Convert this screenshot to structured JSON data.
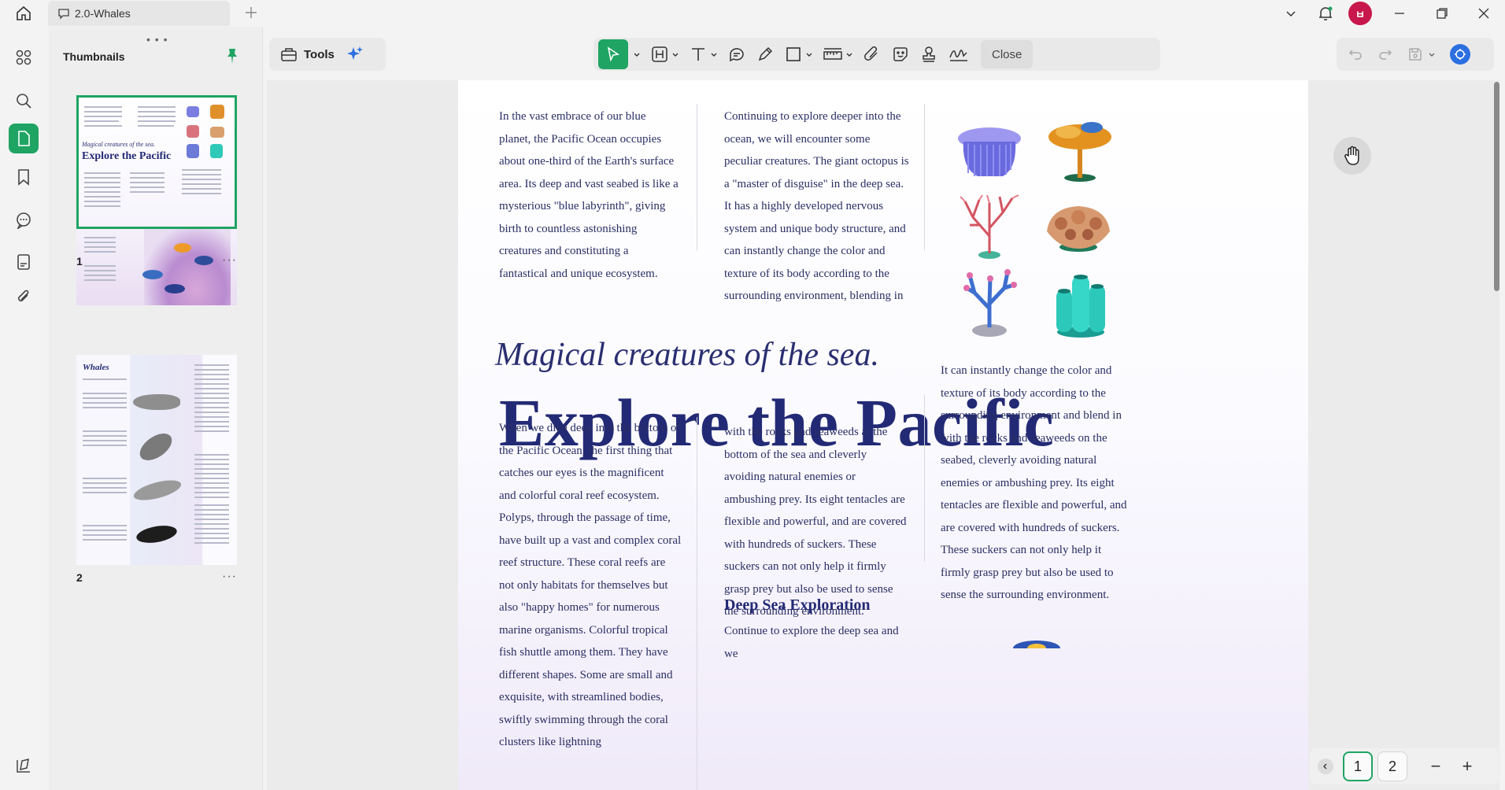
{
  "titlebar": {
    "tab_title": "2.0-Whales",
    "avatar_initial": "ㅂ"
  },
  "sidebar": {
    "title": "Thumbnails",
    "pages": [
      {
        "number": "1",
        "mini_subtitle": "Magical creatures of the sea.",
        "mini_title": "Explore the Pacific"
      },
      {
        "number": "2",
        "mini_title": "Whales"
      }
    ]
  },
  "toolbar": {
    "tools_label": "Tools",
    "close_label": "Close"
  },
  "document": {
    "col1_top": "In the vast embrace of our blue planet, the Pacific Ocean occupies about one-third of the Earth's surface area. Its deep and vast seabed is like a mysterious \"blue labyrinth\", giving birth to countless astonishing creatures and constituting a fantastical and unique ecosystem.",
    "col2_top": "Continuing to explore deeper into the ocean, we will encounter some peculiar creatures. The giant octopus is a \"master of disguise\" in the deep sea. It has a highly developed nervous system and unique body structure, and can instantly change the color and texture of its body according to the surrounding environment, blending in",
    "subtitle": "Magical creatures of the sea.",
    "title": "Explore the Pacific",
    "col3_mid": "It can instantly change the color and texture of its body according to the surrounding environment and blend in with the rocks and seaweeds on the seabed, cleverly avoiding natural enemies or ambushing prey. Its eight tentacles are flexible and powerful, and are covered with hundreds of suckers. These suckers can not only help it firmly grasp prey but also be used to sense the surrounding environment.",
    "col1_bottom": "When we dive deep into the bottom of the Pacific Ocean, the first thing that catches our eyes is the magnificent and colorful coral reef ecosystem. Polyps, through the passage of time, have built up a vast and complex coral reef structure. These coral reefs are not only habitats for themselves but also \"happy homes\" for numerous marine organisms. Colorful tropical fish shuttle among them. They have different shapes. Some are small and exquisite, with streamlined bodies, swiftly swimming through the coral clusters like lightning",
    "col2_bottom": "with the rocks and seaweeds at the bottom of the sea and cleverly avoiding natural enemies or ambushing prey. Its eight tentacles are flexible and powerful, and are covered with hundreds of suckers. These suckers can not only help it firmly grasp prey but also be used to sense the surrounding environment.",
    "heading": "Deep Sea Exploration",
    "col2_tail": "Continue to explore the deep sea and we"
  },
  "pager": {
    "page1": "1",
    "page2": "2",
    "zoom_out": "−",
    "zoom_in": "+"
  },
  "colors": {
    "accent": "#1fa463",
    "title_navy": "#232a75"
  }
}
